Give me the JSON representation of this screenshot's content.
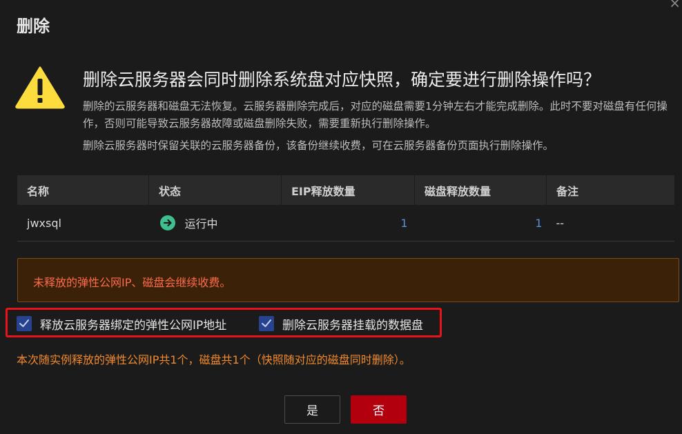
{
  "dialog": {
    "title": "删除",
    "close_glyph": "×",
    "heading": "删除云服务器会同时删除系统盘对应快照，确定要进行删除操作吗？",
    "desc1": "删除的云服务器和磁盘无法恢复。云服务器删除完成后，对应的磁盘需要1分钟左右才能完成删除。此时不要对磁盘有任何操作，否则可能导致云服务器故障或磁盘删除失败，需要重新执行删除操作。",
    "desc2": "删除云服务器时保留关联的云服务器备份，该备份继续收费，可在云服务器备份页面执行删除操作。"
  },
  "table": {
    "headers": [
      "名称",
      "状态",
      "EIP释放数量",
      "磁盘释放数量",
      "备注"
    ],
    "rows": [
      {
        "name": "jwxsql",
        "status": "运行中",
        "eip_count": "1",
        "disk_count": "1",
        "note": "--"
      }
    ]
  },
  "alert": {
    "text": "未释放的弹性公网IP、磁盘会继续收费。"
  },
  "options": {
    "release_eip": {
      "label": "释放云服务器绑定的弹性公网IP地址",
      "checked": true
    },
    "delete_disks": {
      "label": "删除云服务器挂载的数据盘",
      "checked": true
    }
  },
  "summary": "本次随实例释放的弹性公网IP共1个，磁盘共1个（快照随对应的磁盘同时删除）。",
  "buttons": {
    "yes": "是",
    "no": "否"
  },
  "icons": {
    "warning": "warning-triangle-icon",
    "status": "running-status-icon",
    "checkbox": "checkmark-icon"
  },
  "colors": {
    "primary_red": "#b3000e",
    "checkbox_blue": "#27438f",
    "warn_yellow": "#fddc3d",
    "alert_text": "#ff6b4a",
    "summary_text": "#f08a2c",
    "status_green": "#3fbf8f",
    "link_blue": "#5b8fd6"
  }
}
